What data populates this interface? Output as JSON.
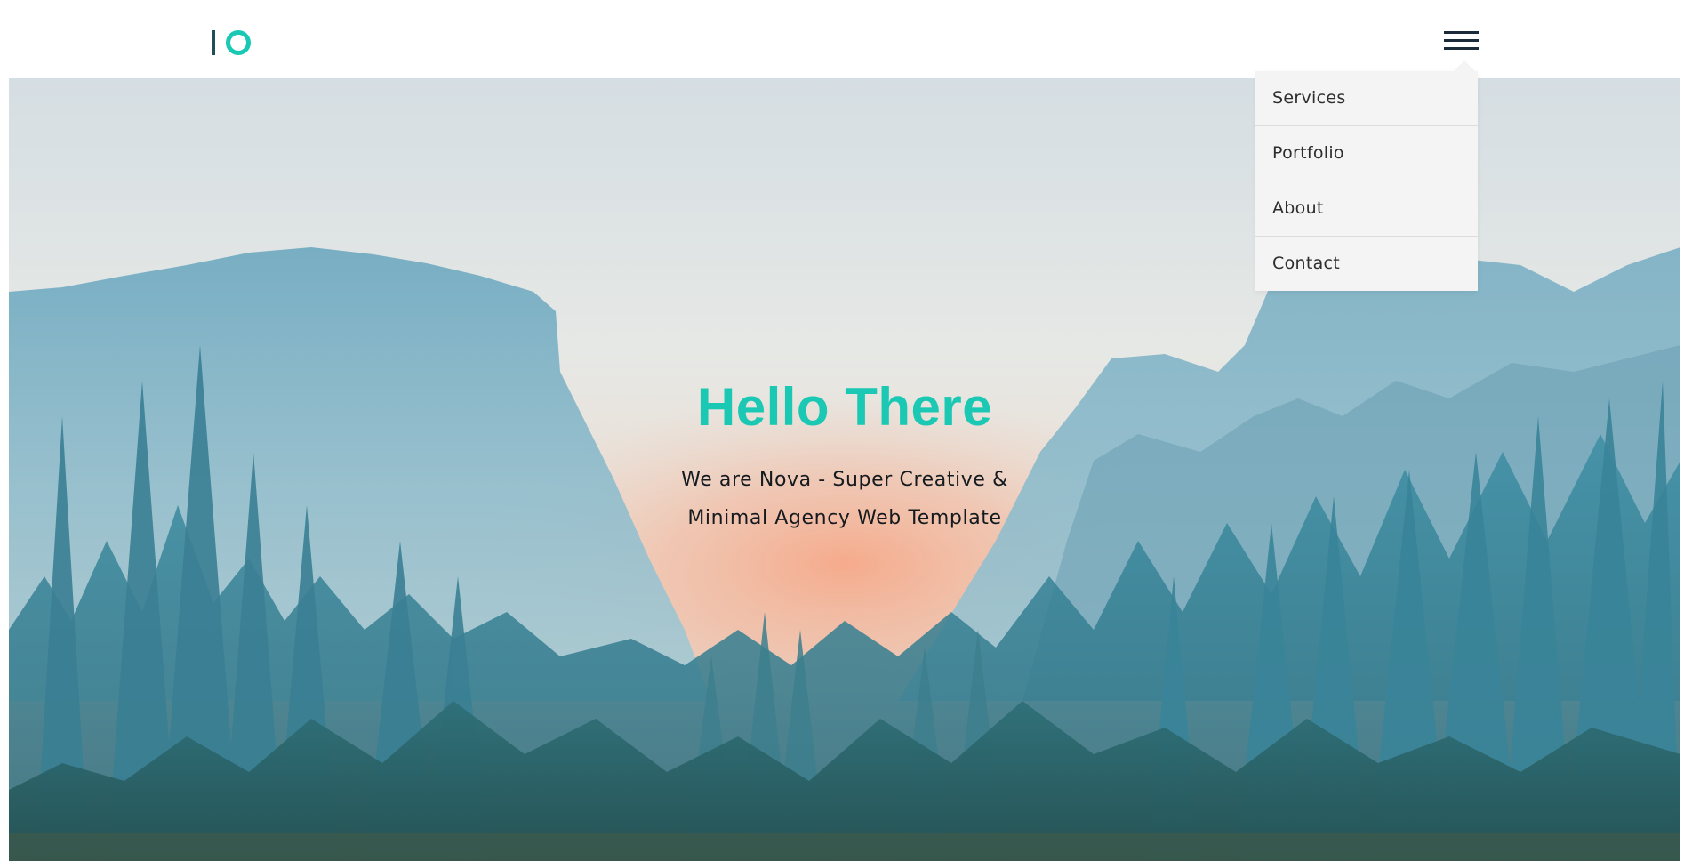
{
  "brand": {
    "logo_icon": "io-logo-icon",
    "accent_color": "#19c9b4",
    "dark_color": "#1e4f5a"
  },
  "nav": {
    "menu_icon": "hamburger-menu-icon",
    "items": [
      {
        "label": "Services"
      },
      {
        "label": "Portfolio"
      },
      {
        "label": "About"
      },
      {
        "label": "Contact"
      }
    ]
  },
  "hero": {
    "title": "Hello There",
    "subtitle_line1": "We are Nova - Super Creative &",
    "subtitle_line2": "Minimal Agency Web Template",
    "background": "misty-mountain-forest-photo"
  }
}
